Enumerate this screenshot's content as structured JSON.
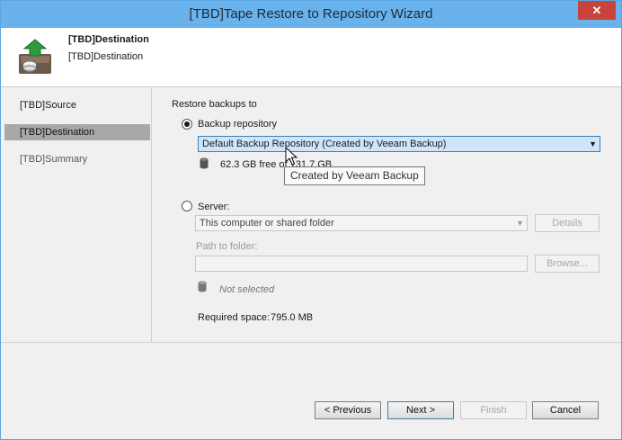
{
  "window": {
    "title": "[TBD]Tape Restore to Repository Wizard",
    "close_glyph": "✕"
  },
  "header": {
    "title": "[TBD]Destination",
    "subtitle": "[TBD]Destination"
  },
  "sidebar": {
    "items": [
      {
        "label": "[TBD]Source",
        "state": "normal"
      },
      {
        "label": "[TBD]Destination",
        "state": "active"
      },
      {
        "label": "[TBD]Summary",
        "state": "dim"
      }
    ]
  },
  "main": {
    "section_label": "Restore backups to",
    "repository_option": {
      "label": "Backup repository",
      "selected": true,
      "combo_value": "Default Backup Repository (Created by Veeam Backup)",
      "free_space": "62.3 GB free of 131.7 GB",
      "tooltip": "Created by Veeam Backup"
    },
    "server_option": {
      "label": "Server:",
      "selected": false,
      "combo_value": "This computer or shared folder",
      "details_label": "Details",
      "path_label": "Path to folder:",
      "path_value": "",
      "browse_label": "Browse...",
      "status": "Not selected"
    },
    "required_space_label": "Required space:",
    "required_space_value": "795.0 MB"
  },
  "footer": {
    "previous_label": "< Previous",
    "next_label": "Next >",
    "finish_label": "Finish",
    "cancel_label": "Cancel"
  },
  "icons": {
    "header": "tape-restore-icon",
    "repository": "database-icon",
    "server_storage": "database-icon",
    "dropdown": "chevron-down-icon",
    "cursor": "mouse-pointer-icon"
  },
  "colors": {
    "titlebar": "#6ab2eb",
    "close_button": "#c9423b",
    "sidebar_active": "#a8a8a8",
    "combo_active": "#cfe6fa"
  }
}
